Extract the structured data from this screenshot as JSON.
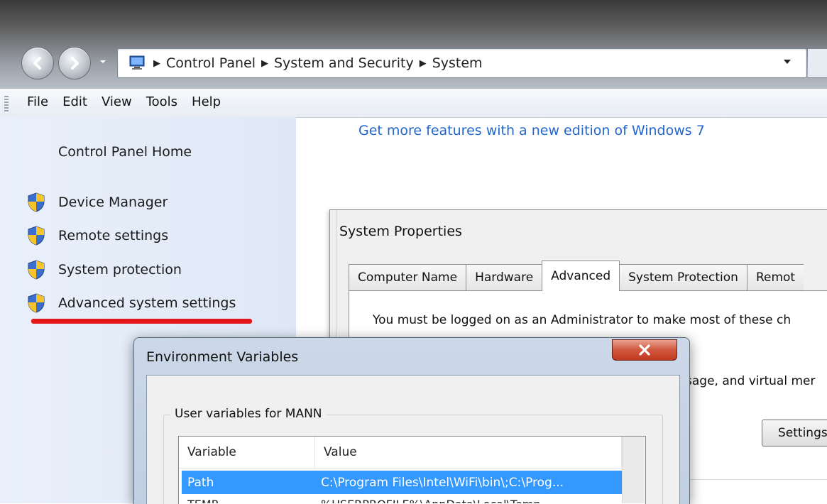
{
  "explorer": {
    "breadcrumbs": [
      "Control Panel",
      "System and Security",
      "System"
    ]
  },
  "menu": {
    "items": [
      "File",
      "Edit",
      "View",
      "Tools",
      "Help"
    ]
  },
  "left_nav": {
    "home": "Control Panel Home",
    "tasks": [
      "Device Manager",
      "Remote settings",
      "System protection",
      "Advanced system settings"
    ]
  },
  "main": {
    "upgrade_link": "Get more features with a new edition of Windows 7"
  },
  "system_properties": {
    "title": "System Properties",
    "tabs": [
      "Computer Name",
      "Hardware",
      "Advanced",
      "System Protection",
      "Remot"
    ],
    "active_tab": "Advanced",
    "admin_note": "You must be logged on as an Administrator to make most of these ch",
    "performance_text": "sage, and virtual mer",
    "settings_button": "Settings"
  },
  "environment_variables": {
    "title": "Environment Variables",
    "user_group_label": "User variables for MANN",
    "columns": [
      "Variable",
      "Value"
    ],
    "rows": [
      {
        "variable": "Path",
        "value": "C:\\Program Files\\Intel\\WiFi\\bin\\;C:\\Prog..."
      },
      {
        "variable": "TEMP",
        "value": "%USERPROFILE%\\AppData\\Local\\Temp"
      }
    ]
  },
  "colors": {
    "link": "#2266cc",
    "selection": "#3399ff",
    "underline": "#e4161b",
    "close_button": "#c0391f"
  }
}
